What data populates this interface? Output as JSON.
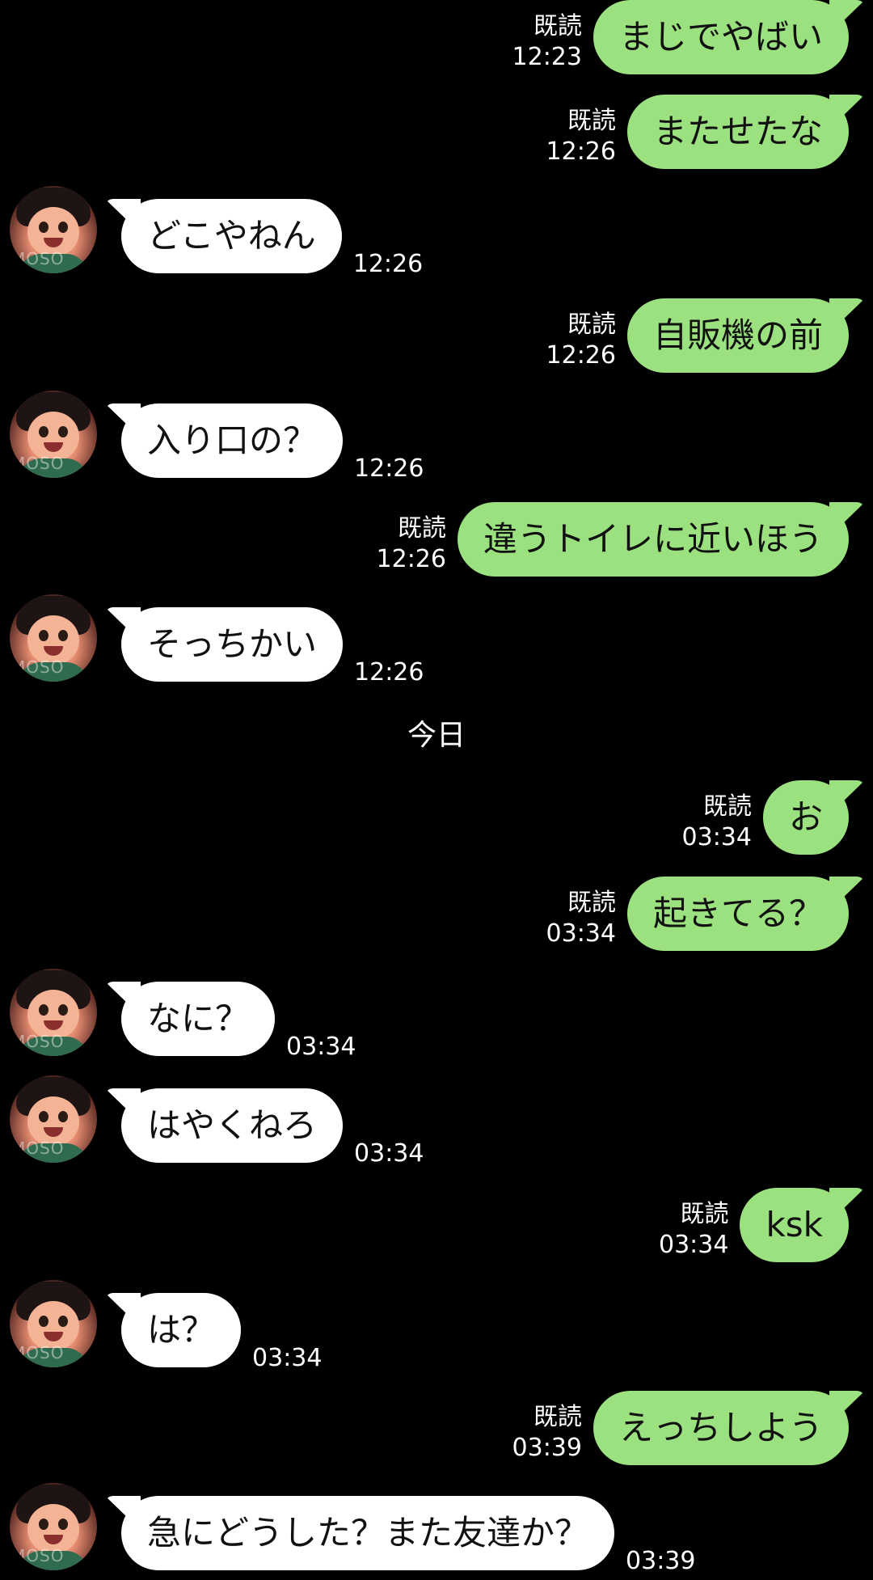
{
  "chat": {
    "date_separator": "今日",
    "avatar_watermark": "MOSO",
    "colors": {
      "background": "#000000",
      "sent_bubble": "#9be17f",
      "received_bubble": "#ffffff",
      "meta_text": "#ffffff"
    },
    "messages": [
      {
        "side": "sent",
        "text": "まじでやばい",
        "read": "既読",
        "time": "12:23"
      },
      {
        "side": "sent",
        "text": "またせたな",
        "read": "既読",
        "time": "12:26"
      },
      {
        "side": "received",
        "text": "どこやねん",
        "time": "12:26"
      },
      {
        "side": "sent",
        "text": "自販機の前",
        "read": "既読",
        "time": "12:26"
      },
      {
        "side": "received",
        "text": "入り口の？",
        "time": "12:26"
      },
      {
        "side": "sent",
        "text": "違うトイレに近いほう",
        "read": "既読",
        "time": "12:26"
      },
      {
        "side": "received",
        "text": "そっちかい",
        "time": "12:26"
      },
      {
        "side": "sent",
        "text": "お",
        "read": "既読",
        "time": "03:34"
      },
      {
        "side": "sent",
        "text": "起きてる？",
        "read": "既読",
        "time": "03:34"
      },
      {
        "side": "received",
        "text": "なに？",
        "time": "03:34"
      },
      {
        "side": "received",
        "text": "はやくねろ",
        "time": "03:34"
      },
      {
        "side": "sent",
        "text": "ksk",
        "read": "既読",
        "time": "03:34"
      },
      {
        "side": "received",
        "text": "は？",
        "time": "03:34"
      },
      {
        "side": "sent",
        "text": "えっちしよう",
        "read": "既読",
        "time": "03:39"
      },
      {
        "side": "received",
        "text": "急にどうした？また友達か？",
        "time": "03:39"
      }
    ]
  }
}
